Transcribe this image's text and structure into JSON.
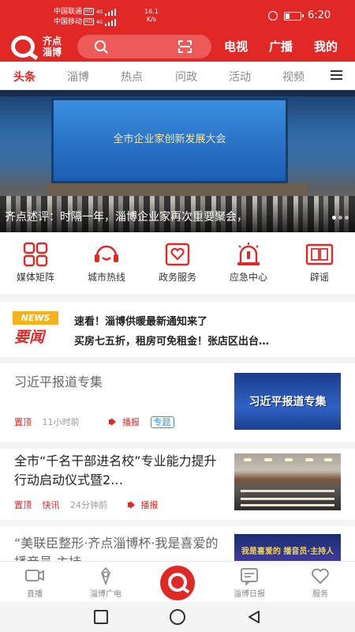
{
  "status_bar": {
    "carrier_1": "中国联通",
    "carrier_2": "中国移动",
    "hd": "HD",
    "net_1": "4G",
    "net_2": "4G",
    "speed_value": "16.1",
    "speed_unit": "K/s",
    "time": "6:20",
    "battery_level": 0.3
  },
  "header": {
    "logo_line1": "齐点",
    "logo_line2": "淄博",
    "nav": [
      "电视",
      "广播",
      "我的"
    ]
  },
  "tabs": [
    "头条",
    "淄博",
    "热点",
    "问政",
    "活动",
    "视频"
  ],
  "active_tab": "头条",
  "banner": {
    "screen_text": "全市企业家创新发展大会",
    "caption": "齐点述评：时隔一年，淄博企业家再次重要聚会，"
  },
  "services": [
    "媒体矩阵",
    "城市热线",
    "政务服务",
    "应急中心",
    "辟谣"
  ],
  "news_strip": {
    "badge_top": "NEWS",
    "badge_bottom": "要闻",
    "headlines": [
      "速看！淄博供暖最新通知来了",
      "买房七五折，租房可免租金！张店区出台…"
    ]
  },
  "articles": [
    {
      "title": "习近平报道专集",
      "tag": "置顶",
      "time": "11小时前",
      "broadcast": "播报",
      "topic": "专题",
      "thumb_text": "习近平报道专集"
    },
    {
      "title": "全市“千名干部进名校”专业能力提升行动启动仪式暨2…",
      "tag": "置顶",
      "tag2": "快讯",
      "time": "24分钟前",
      "broadcast": "播报"
    },
    {
      "title": "“美联臣整形·齐点淄博杯·我是喜爱的 播音员 主持",
      "thumb_text": "我是喜爱的 播音员·主持人"
    }
  ],
  "bottom_nav": [
    "直播",
    "淄博广电",
    "",
    "淄博日报",
    "服务"
  ],
  "colors": {
    "brand_red": "#e02827",
    "news_yellow": "#f5b21b",
    "topic_blue": "#3a8fd8"
  },
  "icons": {
    "services": [
      "media-matrix-icon",
      "hotline-icon",
      "gov-service-icon",
      "emergency-icon",
      "rumor-icon"
    ],
    "bottom_nav": [
      "tv-icon",
      "radio-icon",
      "home-q-icon",
      "newspaper-icon",
      "heart-icon"
    ]
  }
}
